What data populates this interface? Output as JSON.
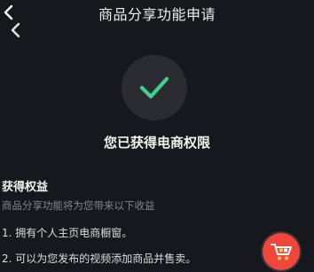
{
  "header": {
    "title": "商品分享功能申请"
  },
  "status": {
    "title": "您已获得电商权限",
    "check_color": "#3fcf8e"
  },
  "benefits": {
    "heading": "获得权益",
    "subtitle": "商品分享功能将为您带来以下收益",
    "items": [
      "1. 拥有个人主页电商橱窗。",
      "2. 可以为您发布的视频添加商品并售卖。"
    ]
  },
  "floating_button": {
    "icon": "shopping-cart-icon",
    "color": "#f0463b"
  }
}
